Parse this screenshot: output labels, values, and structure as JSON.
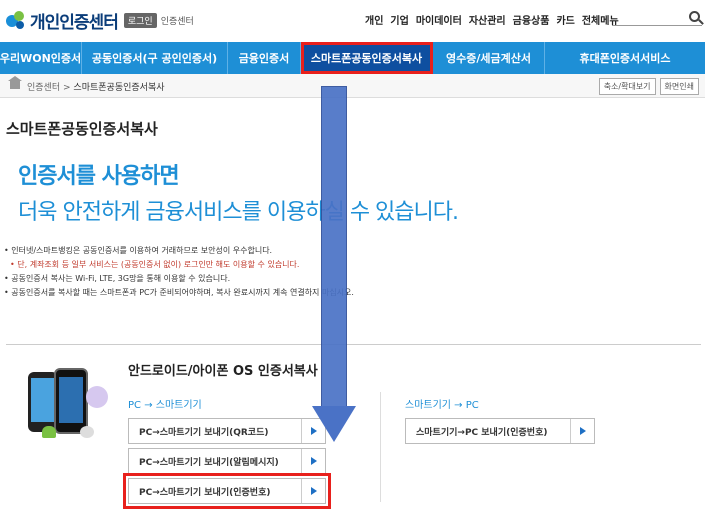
{
  "header": {
    "logo_text": "개인인증센터",
    "login_badge": "로그인",
    "logo_sub": "인증센터",
    "top_menu": [
      "개인",
      "기업",
      "마이데이터",
      "자산관리",
      "금융상품",
      "카드",
      "전체메뉴"
    ]
  },
  "nav": {
    "items": [
      {
        "label": "우리WON인증서",
        "width": 82
      },
      {
        "label": "공동인증서(구 공인인증서)",
        "width": 146
      },
      {
        "label": "금융인증서",
        "width": 73
      },
      {
        "label": "스마트폰공동인증서복사",
        "width": 132,
        "active": true
      },
      {
        "label": "영수증/세금계산서",
        "width": 112
      },
      {
        "label": "휴대폰인증서서비스",
        "width": 160
      }
    ]
  },
  "breadcrumb": {
    "root": "인증센터",
    "separator": ">",
    "current": "스마트폰공동인증서복사",
    "zoom_label": "축소/확대보기",
    "print_label": "화면인쇄"
  },
  "page": {
    "title": "스마트폰공동인증서복사",
    "hero_line1": "인증서를 사용하면",
    "hero_line2": "더욱 안전하게 금융서비스를 이용하실 수 있습니다.",
    "notes": [
      "인터넷/스마트뱅킹은 공동인증서를 이용하여 거래하므로 보안성이 우수합니다.",
      "단, 계좌조회 등 일부 서비스는 (공동인증서 없이) 로그인만 해도 이용할 수 있습니다.",
      "공동인증서 복사는 Wi-Fi, LTE, 3G망을 통해 이용할 수 있습니다.",
      "공동인증서를 복사할 때는 스마트폰과 PC가 준비되어야하며, 복사 완료시까지 계속 연결하지 마십시오."
    ]
  },
  "copy_section": {
    "title": "안드로이드/아이폰 OS 인증서복사",
    "pc_to_phone_head": "PC → 스마트기기",
    "phone_to_pc_head": "스마트기기 → PC",
    "btn_qr": "PC→스마트기기 보내기(QR코드)",
    "btn_push": "PC→스마트기기 보내기(알림메시지)",
    "btn_code": "PC→스마트기기 보내기(인증번호)",
    "btn_reverse": "스마트기기→PC 보내기(인증번호)"
  },
  "colors": {
    "brand_blue": "#1e8fd6",
    "highlight_red": "#e8201c",
    "annotation_arrow": "#4a72c6"
  }
}
